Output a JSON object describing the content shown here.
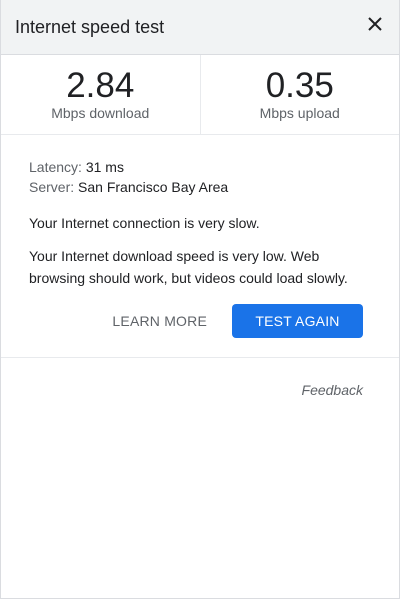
{
  "header": {
    "title": "Internet speed test",
    "close_icon": "close-icon"
  },
  "metrics": {
    "download": {
      "value": "2.84",
      "unit": "Mbps download"
    },
    "upload": {
      "value": "0.35",
      "unit": "Mbps upload"
    }
  },
  "details": {
    "latency_label": "Latency:",
    "latency_value": "31 ms",
    "server_label": "Server:",
    "server_value": "San Francisco Bay Area",
    "message_1": "Your Internet connection is very slow.",
    "message_2": "Your Internet download speed is very low. Web browsing should work, but videos could load slowly."
  },
  "actions": {
    "learn_more": "LEARN MORE",
    "test_again": "TEST AGAIN"
  },
  "feedback": "Feedback",
  "colors": {
    "accent": "#1a73e8",
    "header_bg": "#f1f3f4"
  }
}
